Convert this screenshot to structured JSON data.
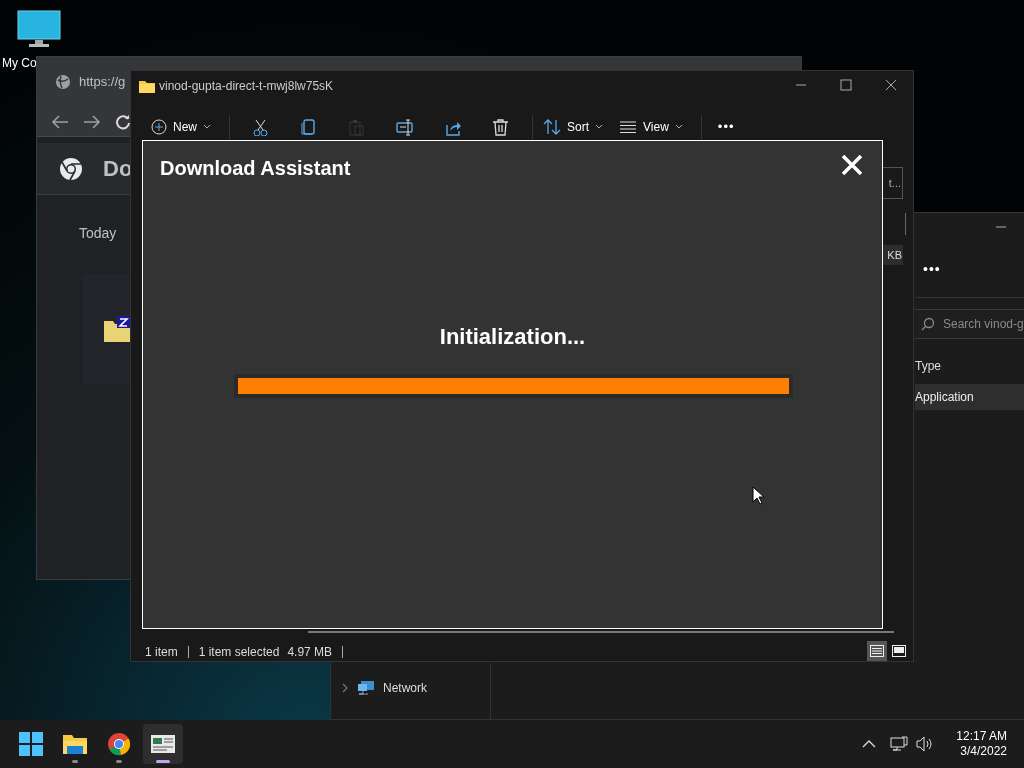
{
  "desktop": {
    "icons": [
      {
        "label": "My Co"
      }
    ]
  },
  "browser_window": {
    "address": "https://g",
    "page_title": "Do",
    "section_label": "Today"
  },
  "explorer_window": {
    "title": "vinod-gupta-direct-t-mwj8lw75sK",
    "toolbar": [
      {
        "kind": "new",
        "label": "New",
        "disabled": false
      },
      {
        "kind": "cut",
        "disabled": false
      },
      {
        "kind": "copy",
        "disabled": false
      },
      {
        "kind": "paste",
        "disabled": true
      },
      {
        "kind": "rename",
        "disabled": false
      },
      {
        "kind": "share",
        "disabled": false
      },
      {
        "kind": "delete",
        "disabled": false
      },
      {
        "kind": "sort",
        "label": "Sort",
        "disabled": false
      },
      {
        "kind": "view",
        "label": "View",
        "disabled": false
      },
      {
        "kind": "more",
        "label": "•••",
        "disabled": false
      }
    ],
    "side_button": "t...",
    "side_size": "KB",
    "status": {
      "item_count": "1 item",
      "selection": "1 item selected",
      "size": "4.97 MB"
    },
    "view_modes": [
      {
        "kind": "details",
        "selected": true
      },
      {
        "kind": "tiles",
        "selected": false
      }
    ]
  },
  "back_window": {
    "more": "•••",
    "search_placeholder": "Search vinod-g",
    "column_header": "Type",
    "row": {
      "cell": "Application",
      "selected": true
    },
    "nav_item": "Network"
  },
  "dialog": {
    "title": "Download Assistant",
    "status": "Initialization...",
    "progress": {
      "level": 1
    }
  },
  "taskbar": {
    "apps": [
      {
        "kind": "start",
        "running": false,
        "selected": false
      },
      {
        "kind": "explorer",
        "running": true,
        "selected": false
      },
      {
        "kind": "chrome",
        "running": true,
        "selected": false
      },
      {
        "kind": "installer",
        "running": true,
        "selected": true
      }
    ],
    "clock": {
      "time": "12:17 AM",
      "date": "3/4/2022"
    }
  }
}
